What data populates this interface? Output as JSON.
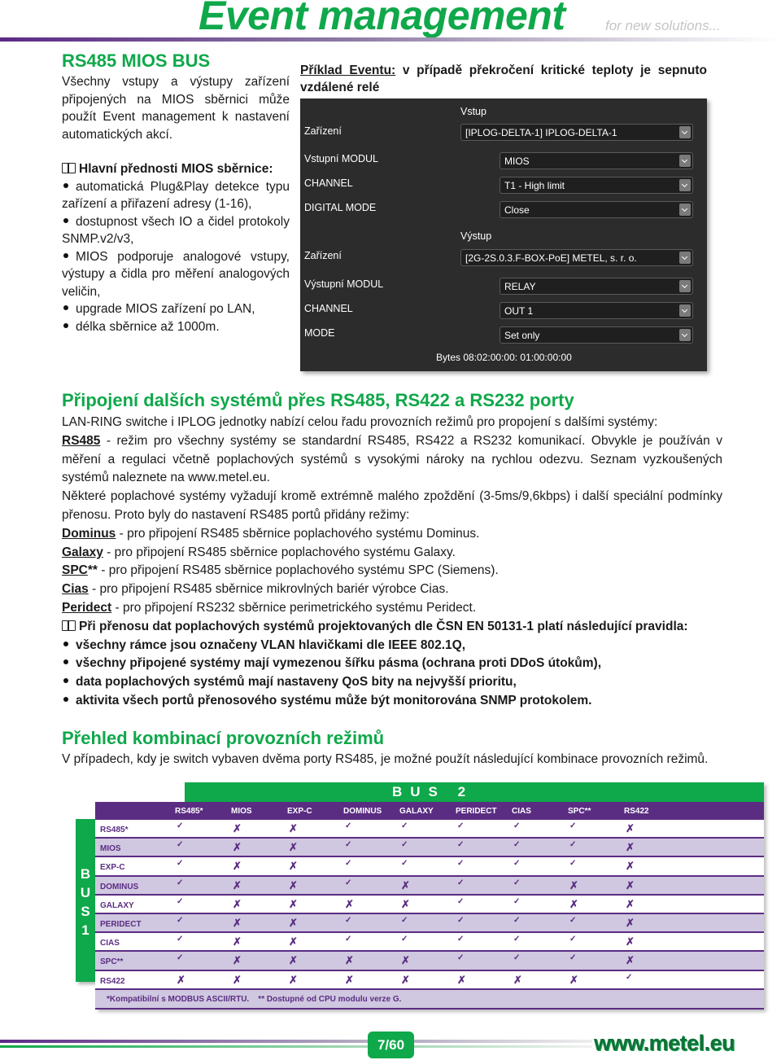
{
  "header": {
    "title": "Event management",
    "tagline": "for new solutions..."
  },
  "mios": {
    "title": "RS485 MIOS BUS",
    "intro": "Všechny vstupy a výstupy zařízení připojených na MIOS sběrnici může použít Event management k nastavení automatických akcí.",
    "features_title": "Hlavní přednosti MIOS sběrnice:",
    "features": [
      "automatická Plug&Play detekce typu zařízení a přiřazení adresy (1-16),",
      "dostupnost všech IO a čidel protokoly SNMP.v2/v3,",
      "MIOS podporuje analogové vstupy, výstupy a čidla pro měření analogových veličin,",
      "upgrade MIOS zařízení po LAN,",
      "délka sběrnice až 1000m."
    ]
  },
  "example": {
    "caption_label": "Příklad Eventu:",
    "caption_text": " v případě překročení kritické teploty je sepnuto vzdálené relé",
    "input_section": "Vstup",
    "output_section": "Výstup",
    "inputs": [
      {
        "label": "Zařízení",
        "value": "[IPLOG-DELTA-1] IPLOG-DELTA-1"
      },
      {
        "label": "Vstupní MODUL",
        "value": "MIOS"
      },
      {
        "label": "CHANNEL",
        "value": "T1 - High limit"
      },
      {
        "label": "DIGITAL MODE",
        "value": "Close"
      }
    ],
    "outputs": [
      {
        "label": "Zařízení",
        "value": "[2G-2S.0.3.F-BOX-PoE] METEL, s. r. o."
      },
      {
        "label": "Výstupní MODUL",
        "value": "RELAY"
      },
      {
        "label": "CHANNEL",
        "value": "OUT 1"
      },
      {
        "label": "MODE",
        "value": "Set only"
      }
    ],
    "bytes": "Bytes 08:02:00:00: 01:00:00:00"
  },
  "ports": {
    "title": "Připojení dalších systémů přes RS485, RS422 a RS232 porty",
    "intro": "LAN-RING switche i IPLOG jednotky nabízí celou řadu provozních režimů pro propojení s dalšími systémy:",
    "rs485_label": "RS485",
    "rs485_text": " - režim pro všechny systémy se standardní RS485, RS422 a RS232 komunikací. Obvykle je používán v měření a regulaci včetně poplachových systémů s vysokými nároky na rychlou odezvu. Seznam vyzkoušených systémů naleznete na www.metel.eu.",
    "special_text": "Některé poplachové systémy vyžadují kromě extrémně malého zpoždění (3-5ms/9,6kbps) i další speciální podmínky přenosu. Proto byly do nastavení RS485 portů přidány režimy:",
    "modes": [
      {
        "name": "Dominus",
        "suffix": "",
        "desc": " - pro připojení RS485 sběrnice poplachového systému Dominus."
      },
      {
        "name": "Galaxy",
        "suffix": "",
        "desc": " - pro připojení RS485 sběrnice poplachového systému Galaxy."
      },
      {
        "name": "SPC",
        "suffix": "**",
        "desc": " - pro připojení RS485 sběrnice poplachového systému SPC (Siemens)."
      },
      {
        "name": "Cias",
        "suffix": "",
        "desc": " - pro připojení RS485 sběrnice mikrovlných bariér výrobce Cias."
      },
      {
        "name": "Peridect",
        "suffix": "",
        "desc": " - pro připojení RS232 sběrnice perimetrického systému Peridect."
      }
    ],
    "rules_title": "Při přenosu dat poplachových systémů projektovaných dle ČSN EN 50131-1 platí následující pravidla:",
    "rules": [
      "všechny rámce jsou označeny VLAN hlavičkami dle IEEE 802.1Q,",
      "všechny připojené systémy mají vymezenou šířku pásma (ochrana proti DDoS útokům),",
      "data poplachových systémů mají nastaveny QoS bity na nejvyšší prioritu,",
      "aktivita všech portů přenosového systému může být monitorována SNMP protokolem."
    ]
  },
  "overview": {
    "title": "Přehled kombinací provozních režimů",
    "text": "V případech, kdy je switch vybaven dvěma porty RS485, je možné použít následující kombinace provozních režimů."
  },
  "table": {
    "bus2_label": "BUS 2",
    "bus1_label": [
      "B",
      "U",
      "S",
      "1"
    ],
    "columns": [
      "RS485*",
      "MIOS",
      "EXP-C",
      "DOMINUS",
      "GALAXY",
      "PERIDECT",
      "CIAS",
      "SPC**",
      "RS422"
    ],
    "rows": [
      {
        "label": "RS485*",
        "values": [
          1,
          0,
          0,
          1,
          1,
          1,
          1,
          1,
          0
        ]
      },
      {
        "label": "MIOS",
        "values": [
          1,
          0,
          0,
          1,
          1,
          1,
          1,
          1,
          0
        ]
      },
      {
        "label": "EXP-C",
        "values": [
          1,
          0,
          0,
          1,
          1,
          1,
          1,
          1,
          0
        ]
      },
      {
        "label": "DOMINUS",
        "values": [
          1,
          0,
          0,
          1,
          0,
          1,
          1,
          0,
          0
        ]
      },
      {
        "label": "GALAXY",
        "values": [
          1,
          0,
          0,
          0,
          0,
          1,
          1,
          0,
          0
        ]
      },
      {
        "label": "PERIDECT",
        "values": [
          1,
          0,
          0,
          1,
          1,
          1,
          1,
          1,
          0
        ]
      },
      {
        "label": "CIAS",
        "values": [
          1,
          0,
          0,
          1,
          1,
          1,
          1,
          1,
          0
        ]
      },
      {
        "label": "SPC**",
        "values": [
          1,
          0,
          0,
          0,
          0,
          1,
          1,
          1,
          0
        ]
      },
      {
        "label": "RS422",
        "values": [
          0,
          0,
          0,
          0,
          0,
          0,
          0,
          0,
          1
        ]
      }
    ],
    "check_symbol": "✓",
    "cross_symbol": "✗",
    "footnote": "*Kompatibilní s MODBUS ASCII/RTU.    ** Dostupné od CPU modulu verze G.",
    "colors": {
      "green": "#0fa84a",
      "purple": "#5a2d82",
      "lavender": "#d0c7e0"
    }
  },
  "footer": {
    "page": "7/60",
    "website": "www.metel.eu"
  }
}
